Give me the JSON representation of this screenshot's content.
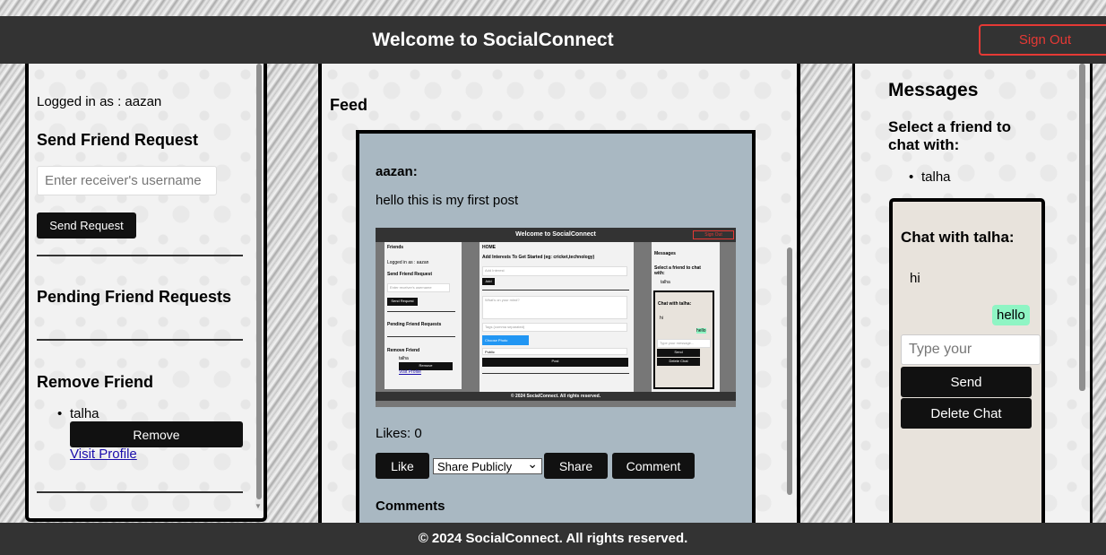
{
  "header": {
    "title": "Welcome to SocialConnect",
    "sign_out_label": "Sign Out"
  },
  "left": {
    "logged_in": "Logged in as : aazan",
    "send_request_heading": "Send Friend Request",
    "receiver_placeholder": "Enter receiver's username",
    "send_request_button": "Send Request",
    "pending_heading": "Pending Friend Requests",
    "remove_heading": "Remove Friend",
    "friend_name": "talha",
    "remove_button": "Remove",
    "visit_profile": "Visit Profile"
  },
  "feed": {
    "heading": "Feed",
    "post": {
      "author": "aazan:",
      "text": "hello this is my first post",
      "likes": "Likes: 0",
      "like_button": "Like",
      "share_option": "Share Publicly",
      "share_button": "Share",
      "comment_button": "Comment",
      "comments_heading": "Comments",
      "image": {
        "title": "Welcome to SocialConnect",
        "sign_out": "Sign Out",
        "friends": "Friends",
        "logged_in": "Logged in as : aazan",
        "send_heading": "Send Friend Request",
        "receiver_placeholder": "Enter receiver's username",
        "send_button": "Send Request",
        "pending": "Pending Friend Requests",
        "remove_heading": "Remove Friend",
        "friend": "talha",
        "remove_button": "Remove",
        "visit": "Visit Profile",
        "home": "HOME",
        "interests_heading": "Add Interests To Get Started (eg: cricket,technology)",
        "interest_placeholder": "Add Interest",
        "add_button": "Add",
        "mind_placeholder": "What's on your mind?",
        "tags_placeholder": "Tags (comma separated)",
        "choose_photo": "Choose Photo",
        "visibility": "Public",
        "post_button": "Post",
        "messages": "Messages",
        "select_friend": "Select a friend to chat with:",
        "chat_with": "Chat with talha:",
        "msg_hi": "hi",
        "msg_hello": "hello",
        "type_placeholder": "Type your message...",
        "send": "Send",
        "delete_chat": "Delete Chat",
        "footer": "© 2024 SocialConnect. All rights reserved."
      }
    }
  },
  "messages": {
    "heading": "Messages",
    "select_friend": "Select a friend to chat with:",
    "friend": "talha",
    "chat_heading": "Chat with talha:",
    "msg_received": "hi",
    "msg_sent": "hello",
    "input_placeholder": "Type your message...",
    "send_button": "Send",
    "delete_button": "Delete Chat"
  },
  "footer": {
    "text": "© 2024 SocialConnect. All rights reserved."
  },
  "colors": {
    "header_bg": "#333333",
    "sign_out": "#e53935",
    "post_bg": "#a9b8c2",
    "sent_bubble": "#8ff5c4"
  }
}
